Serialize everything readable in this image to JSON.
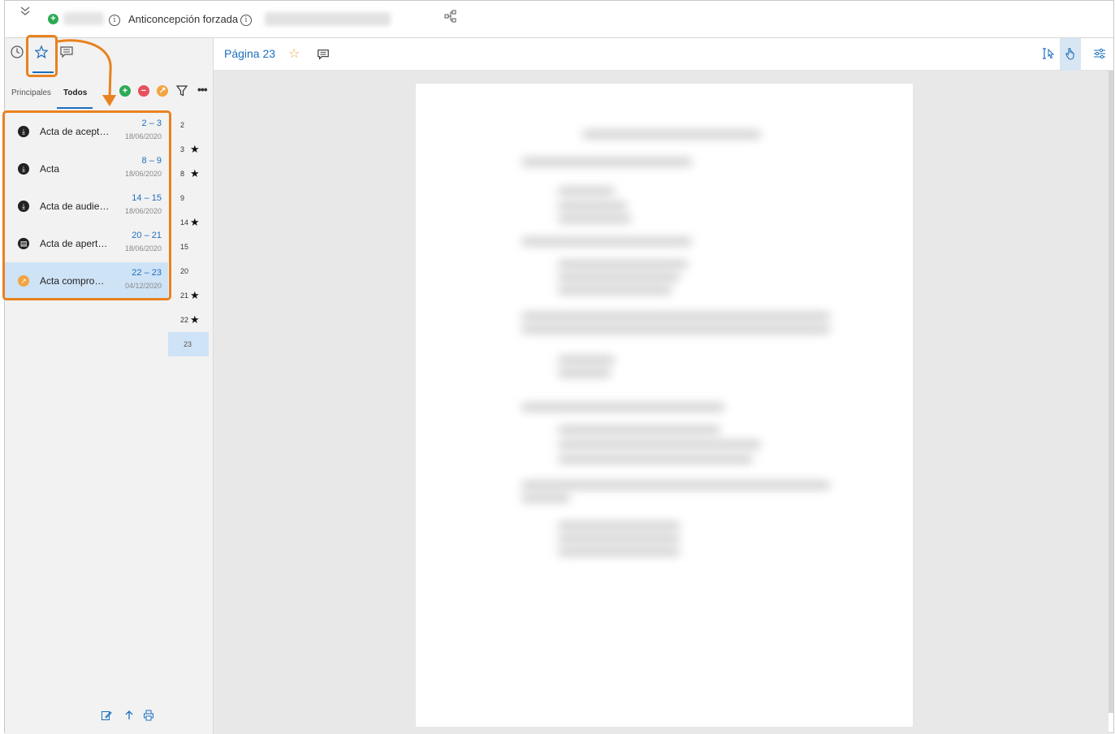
{
  "topbar": {
    "collapse_icon": "double-chevron-down-icon",
    "case_title": "Anticoncepción forzada",
    "tree_icon": "hierarchy-icon"
  },
  "left_panel": {
    "tabs": [
      {
        "name": "history",
        "icon": "clock-icon"
      },
      {
        "name": "favorites",
        "icon": "star-icon",
        "active": true
      },
      {
        "name": "comments",
        "icon": "comment-icon"
      }
    ],
    "subtabs": [
      {
        "label": "Principales"
      },
      {
        "label": "Todos",
        "active": true
      }
    ],
    "documents": [
      {
        "name": "Acta de acept…",
        "pages": "2 – 3",
        "date": "18/06/2020",
        "icon": "download-icon"
      },
      {
        "name": "Acta",
        "pages": "8 – 9",
        "date": "18/06/2020",
        "icon": "download-icon"
      },
      {
        "name": "Acta de audie…",
        "pages": "14 – 15",
        "date": "18/06/2020",
        "icon": "download-icon"
      },
      {
        "name": "Acta de apert…",
        "pages": "20 – 21",
        "date": "18/06/2020",
        "icon": "document-icon"
      },
      {
        "name": "Acta compro…",
        "pages": "22 – 23",
        "date": "04/12/2020",
        "icon": "arrow-out-icon",
        "selected": true
      }
    ],
    "page_list": [
      {
        "num": "2",
        "starred": false
      },
      {
        "num": "3",
        "starred": true
      },
      {
        "num": "8",
        "starred": true
      },
      {
        "num": "9",
        "starred": false
      },
      {
        "num": "14",
        "starred": true
      },
      {
        "num": "15",
        "starred": false
      },
      {
        "num": "20",
        "starred": false
      },
      {
        "num": "21",
        "starred": true
      },
      {
        "num": "22",
        "starred": true
      },
      {
        "num": "23",
        "starred": false,
        "selected": true
      }
    ],
    "star_glyph": "★"
  },
  "viewer": {
    "page_title": "Página 23",
    "star_glyph": "☆"
  },
  "colors": {
    "accent": "#1c6fbc",
    "highlight": "#e8821f",
    "selected_bg": "#cfe3f6",
    "add_green": "#2eaa55",
    "remove_red": "#e8505b",
    "orange_btn": "#f2a541"
  }
}
